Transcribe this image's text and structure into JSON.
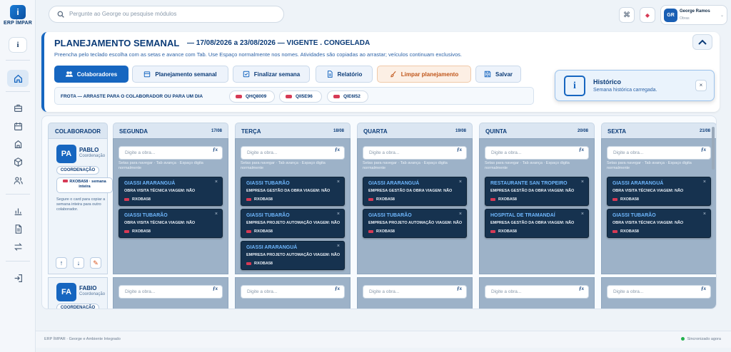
{
  "app": {
    "logo_letter": "i",
    "logo_text": "ERP ÍMPAR"
  },
  "sidebar": {
    "info_label": "i",
    "items": [
      {
        "name": "home",
        "glyph": "⌂"
      },
      {
        "name": "briefcase",
        "glyph": ""
      },
      {
        "name": "calendar",
        "glyph": ""
      },
      {
        "name": "building",
        "glyph": ""
      },
      {
        "name": "cube",
        "glyph": ""
      },
      {
        "name": "users",
        "glyph": ""
      },
      {
        "name": "chart",
        "glyph": ""
      },
      {
        "name": "document",
        "glyph": ""
      },
      {
        "name": "transfer",
        "glyph": ""
      },
      {
        "name": "logout",
        "glyph": ""
      }
    ]
  },
  "topbar": {
    "search_placeholder": "Pergunte ao George ou pesquise módulos",
    "user": {
      "initials": "GR",
      "name": "George Ramos",
      "role": "Obras",
      "caret": "⌄"
    }
  },
  "header": {
    "title": "PLANEJAMENTO SEMANAL",
    "subtitle": "— 17/08/2026 a 23/08/2026 — VIGENTE . CONGELADA",
    "hint": "Preencha pelo teclado escolha com as setas e avance com Tab. Use Espaço normalmente nos nomes. Atividades são copiadas ao arrastar; veículos continuam exclusivos.",
    "actions": {
      "colaboradores": "Colaboradores",
      "planejamento": "Planejamento semanal",
      "finalizar": "Finalizar semana",
      "relatorio": "Relatório",
      "limpar": "Limpar planejamento",
      "salvar": "Salvar"
    },
    "frota_label": "FROTA — ARRASTE PARA O COLABORADOR OU PARA UM DIA",
    "vehicles": [
      "QHQ8009",
      "QII5E96",
      "QIE6I52"
    ]
  },
  "toast": {
    "title": "Histórico",
    "message": "Semana histórica carregada.",
    "close": "×"
  },
  "board": {
    "collab_header": "COLABORADOR",
    "days": [
      {
        "name": "SEGUNDA",
        "date": "17/08"
      },
      {
        "name": "TERÇA",
        "date": "18/08"
      },
      {
        "name": "QUARTA",
        "date": "19/08"
      },
      {
        "name": "QUINTA",
        "date": "20/08"
      },
      {
        "name": "SEXTA",
        "date": "21/08"
      }
    ],
    "input_placeholder": "Digite a obra...",
    "fx": "ƒx",
    "input_hint": "Setas para navegar · Tab avança · Espaço digita normalmente",
    "collaborators": [
      {
        "initials": "PA",
        "name": "PABLO",
        "role": "Coordenação",
        "role_pill": "COORDENAÇÃO",
        "vehicle": "RXOBA58 · semana inteira",
        "drag_hint": "Segure o card para copiar a semana inteira para outro colaborador.",
        "controls": [
          "↑",
          "↓",
          "✎"
        ],
        "days": [
          [
            {
              "title": "GIASSI ARARANGUÁ",
              "meta": "OBRA   VISITA TÉCNICA    VIAGEM: NÃO",
              "vehicle": "RXOBA58"
            },
            {
              "title": "GIASSI TUBARÃO",
              "meta": "OBRA   VISITA TÉCNICA    VIAGEM: NÃO",
              "vehicle": "RXOBA58"
            }
          ],
          [
            {
              "title": "GIASSI TUBARÃO",
              "meta": "EMPRESA   GESTÃO DA OBRA    VIAGEM: NÃO",
              "vehicle": "RXOBA58"
            },
            {
              "title": "GIASSI TUBARÃO",
              "meta": "EMPRESA   PROJETO AUTOMAÇÃO    VIAGEM: NÃO",
              "vehicle": "RXOBA58"
            },
            {
              "title": "GIASSI ARARANGUÁ",
              "meta": "EMPRESA   PROJETO AUTOMAÇÃO    VIAGEM: NÃO",
              "vehicle": "RXOBA58"
            }
          ],
          [
            {
              "title": "GIASSI ARARANGUÁ",
              "meta": "EMPRESA   GESTÃO DA OBRA    VIAGEM: NÃO",
              "vehicle": "RXOBA58"
            },
            {
              "title": "GIASSI TUBARÃO",
              "meta": "EMPRESA   PROJETO AUTOMAÇÃO    VIAGEM: NÃO",
              "vehicle": "RXOBA58"
            }
          ],
          [
            {
              "title": "RESTAURANTE SAN TROPEIRO",
              "meta": "EMPRESA   GESTÃO DA OBRA    VIAGEM: NÃO",
              "vehicle": "RXOBA58"
            },
            {
              "title": "HOSPITAL DE TRAMANDAÍ",
              "meta": "EMPRESA   GESTÃO DA OBRA    VIAGEM: NÃO",
              "vehicle": "RXOBA58"
            }
          ],
          [
            {
              "title": "GIASSI ARARANGUÁ",
              "meta": "OBRA   VISITA TÉCNICA    VIAGEM: NÃO",
              "vehicle": "RXOBA58"
            },
            {
              "title": "GIASSI TUBARÃO",
              "meta": "OBRA   VISITA TÉCNICA    VIAGEM: NÃO",
              "vehicle": "RXOBA58"
            }
          ]
        ]
      },
      {
        "initials": "FA",
        "name": "FABIO",
        "role": "Coordenação",
        "role_pill": "COORDENAÇÃO"
      }
    ]
  },
  "footer": {
    "left": "ERP ÍMPAR · George e Ambiente Integrado",
    "right": "Sincronizado agora"
  }
}
